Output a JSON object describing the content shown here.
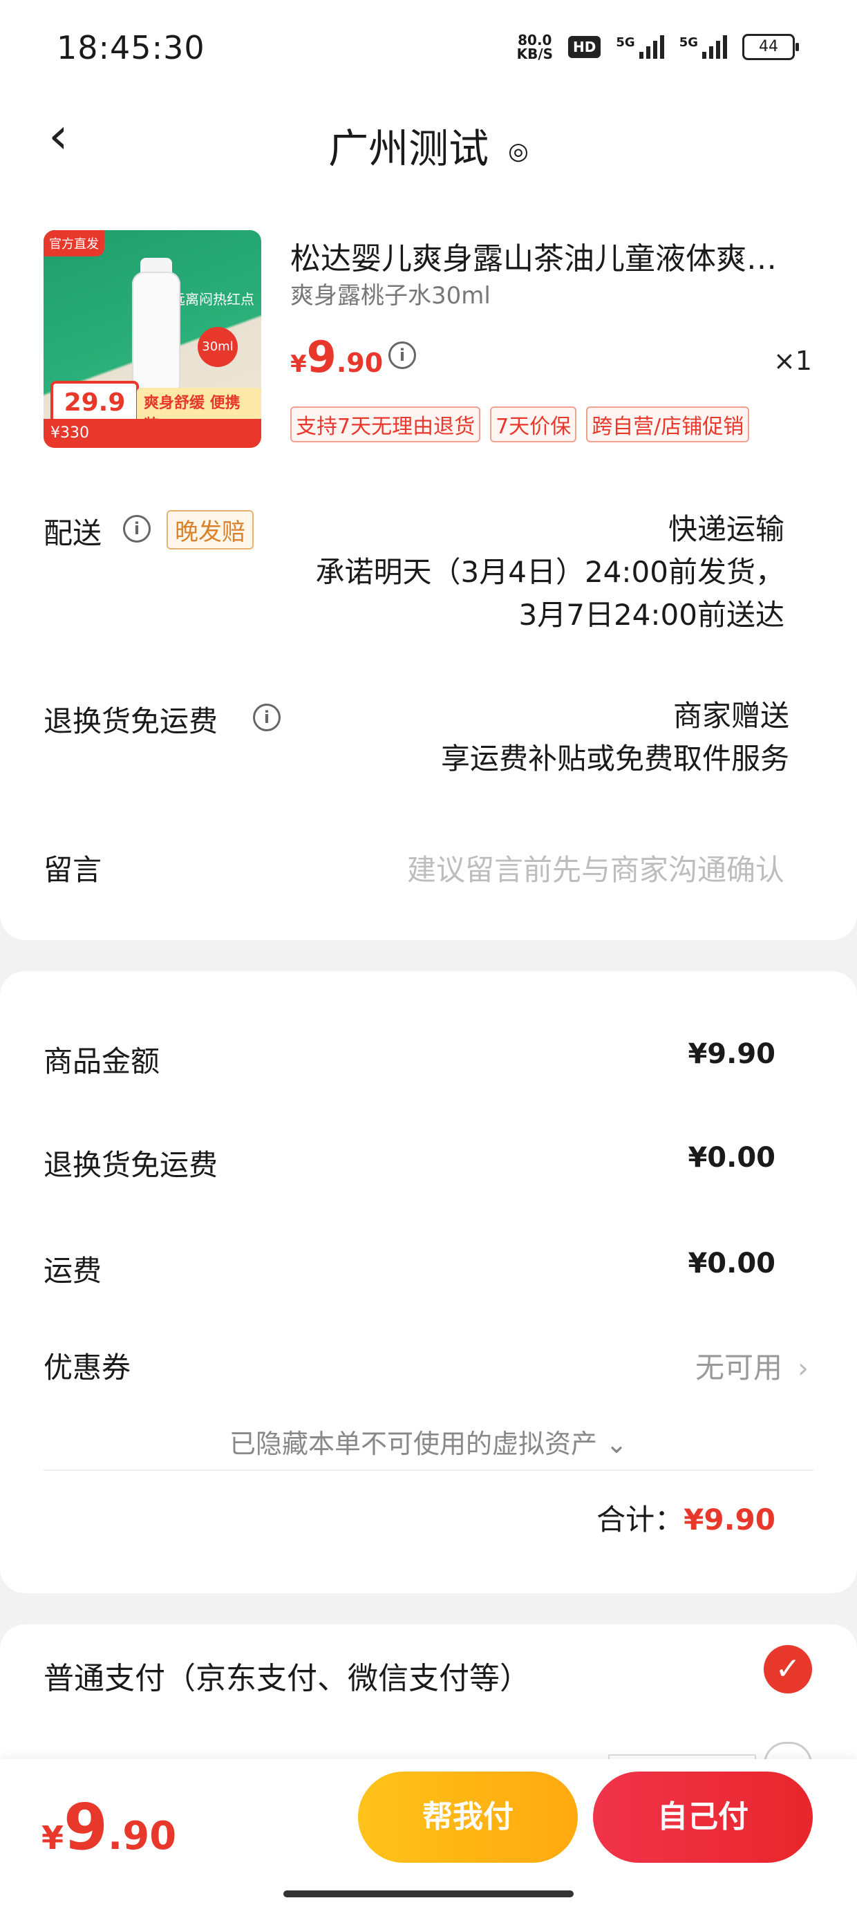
{
  "status_bar": {
    "time": "18:45:30",
    "net_speed": "80.0",
    "net_unit": "KB/S",
    "hd": "HD",
    "sig1": "5G",
    "sig2": "5G",
    "battery": "44"
  },
  "header": {
    "title": "广州测试",
    "back_icon": "chevron-left-icon",
    "location_icon": "location-pin-icon"
  },
  "product": {
    "title": "松达婴儿爽身露山茶油儿童液体爽…",
    "spec": "爽身露桃子水30ml",
    "price_symbol": "¥",
    "price_int": "9",
    "price_dec": ".90",
    "quantity": "×1",
    "tags": [
      "支持7天无理由退货",
      "7天价保",
      "跨自营/店铺促销"
    ],
    "image": {
      "corner": "官方直发",
      "promo_text": "远离闷热红点",
      "ml": "30ml",
      "tag_price": "29.9",
      "slogan": "爽身舒缓 便携装",
      "banner": "¥330"
    }
  },
  "delivery": {
    "label": "配送",
    "badge": "晚发赔",
    "method": "快递运输",
    "promise_line1": "承诺明天（3月4日）24:00前发货，",
    "promise_line2": "3月7日24:00前送达"
  },
  "return_shipping": {
    "label": "退换货免运费",
    "value": "商家赠送",
    "sub": "享运费补贴或免费取件服务"
  },
  "message": {
    "label": "留言",
    "placeholder": "建议留言前先与商家沟通确认"
  },
  "summary": {
    "goods_label": "商品金额",
    "goods_value": "¥9.90",
    "return_label": "退换货免运费",
    "return_value": "¥0.00",
    "shipping_label": "运费",
    "shipping_value": "¥0.00",
    "coupon_label": "优惠券",
    "coupon_value": "无可用",
    "hidden_note": "已隐藏本单不可使用的虚拟资产 ⌄",
    "total_label": "合计：",
    "total_value": "¥9.90"
  },
  "payment": {
    "option_label": "普通支付（京东支付、微信支付等）",
    "selected": true
  },
  "bottom": {
    "price_symbol": "¥",
    "price_int": "9",
    "price_dec": ".90",
    "help_pay": "帮我付",
    "self_pay": "自己付"
  },
  "colors": {
    "accent": "#e8382c",
    "help_button": "#ffb414",
    "self_button": "#ec2d3a"
  }
}
